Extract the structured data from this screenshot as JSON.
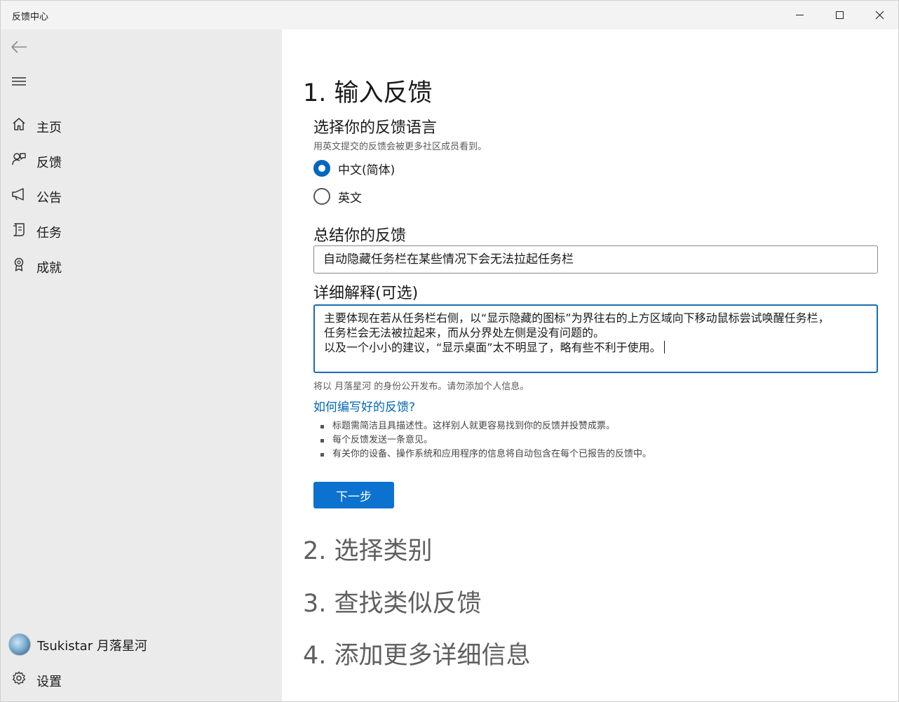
{
  "window": {
    "title": "反馈中心"
  },
  "sidebar": {
    "items": [
      {
        "label": "主页",
        "icon": "home-icon"
      },
      {
        "label": "反馈",
        "icon": "feedback-icon"
      },
      {
        "label": "公告",
        "icon": "megaphone-icon"
      },
      {
        "label": "任务",
        "icon": "quest-icon"
      },
      {
        "label": "成就",
        "icon": "achievement-icon"
      }
    ],
    "user": {
      "name": "Tsukistar 月落星河"
    },
    "settings": {
      "label": "设置",
      "icon": "gear-icon"
    }
  },
  "main": {
    "step1": {
      "title": "1. 输入反馈",
      "language": {
        "label": "选择你的反馈语言",
        "hint": "用英文提交的反馈会被更多社区成员看到。",
        "options": [
          {
            "label": "中文(简体)",
            "selected": true
          },
          {
            "label": "英文",
            "selected": false
          }
        ]
      },
      "summary": {
        "label": "总结你的反馈",
        "value": "自动隐藏任务栏在某些情况下会无法拉起任务栏"
      },
      "details": {
        "label": "详细解释(可选)",
        "lines": [
          "主要体现在若从任务栏右侧，以“显示隐藏的图标”为界往右的上方区域向下移动鼠标尝试唤醒任务栏，",
          "任务栏会无法被拉起来，而从分界处左侧是没有问题的。",
          "以及一个小小的建议，“显示桌面”太不明显了，略有些不利于使用。"
        ]
      },
      "public_note": "将以 月落星河 的身份公开发布。请勿添加个人信息。",
      "howto_link": "如何编写好的反馈?",
      "tips": [
        "标题需简洁且具描述性。这样别人就更容易找到你的反馈并投赞成票。",
        "每个反馈发送一条意见。",
        "有关你的设备、操作系统和应用程序的信息将自动包含在每个已报告的反馈中。"
      ],
      "next_button": "下一步"
    },
    "step2": {
      "title": "2. 选择类别"
    },
    "step3": {
      "title": "3. 查找类似反馈"
    },
    "step4": {
      "title": "4. 添加更多详细信息"
    }
  },
  "colors": {
    "accent": "#0067c0",
    "button": "#0c72d0",
    "link": "#0067b8",
    "sidebar_bg": "#ebebeb"
  }
}
